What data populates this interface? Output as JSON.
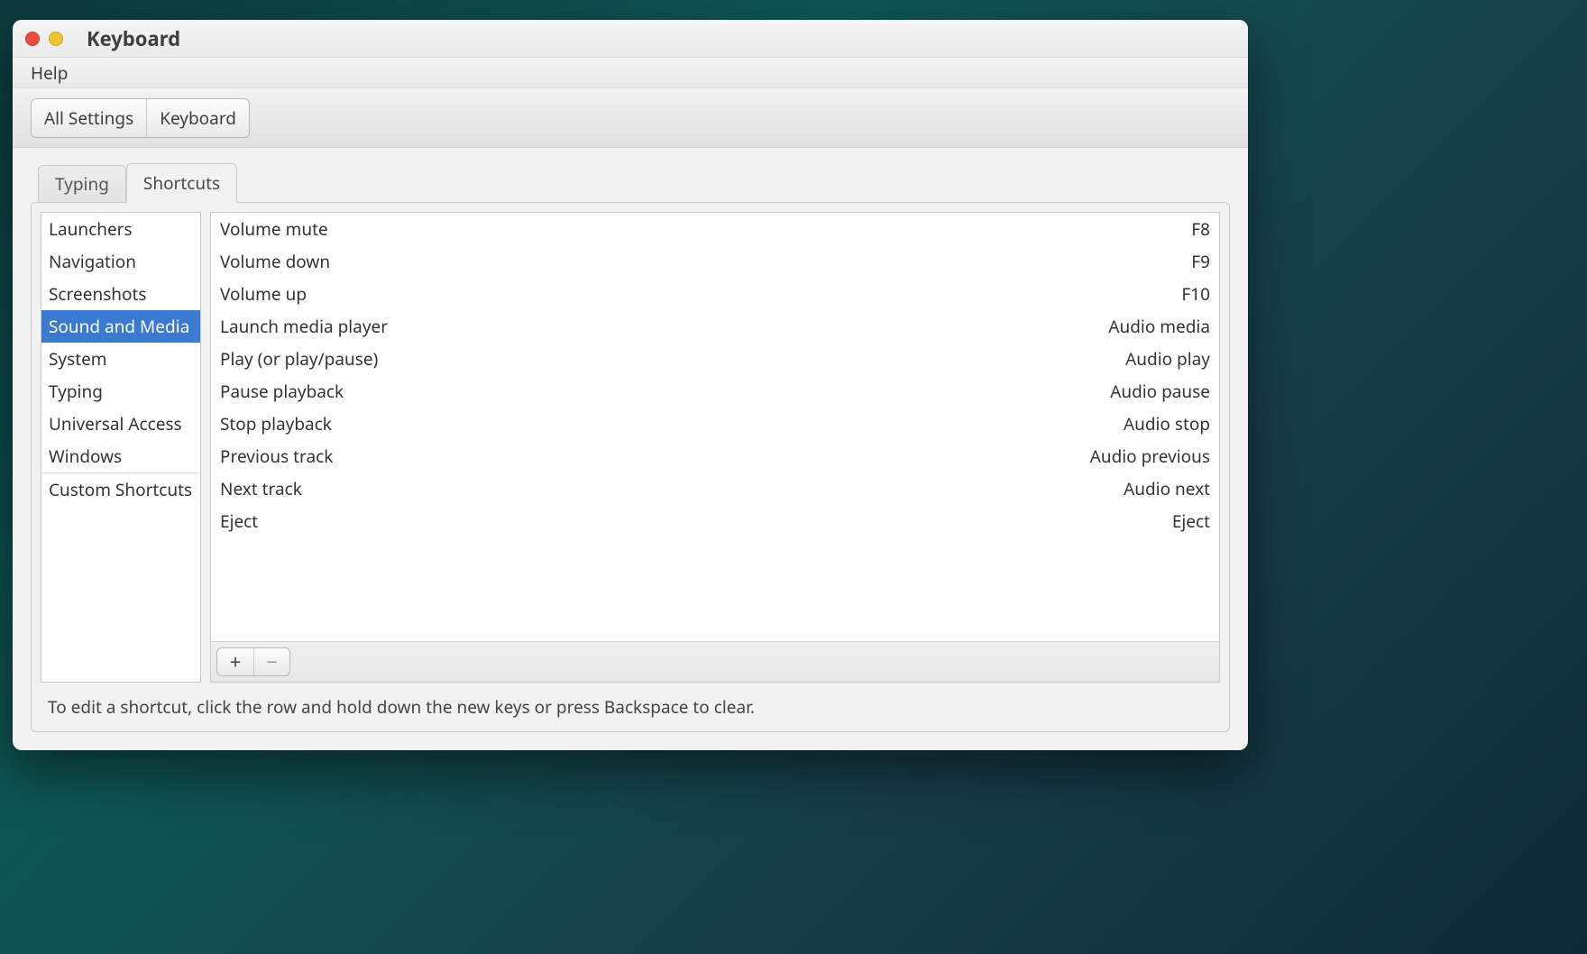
{
  "window": {
    "title": "Keyboard"
  },
  "menubar": {
    "help": "Help"
  },
  "breadcrumb": {
    "all_settings": "All Settings",
    "keyboard": "Keyboard"
  },
  "tabs": {
    "typing": "Typing",
    "shortcuts": "Shortcuts"
  },
  "sidebar": {
    "items": [
      "Launchers",
      "Navigation",
      "Screenshots",
      "Sound and Media",
      "System",
      "Typing",
      "Universal Access",
      "Windows"
    ],
    "custom": "Custom Shortcuts",
    "selected_index": 3
  },
  "shortcuts": [
    {
      "label": "Volume mute",
      "key": "F8"
    },
    {
      "label": "Volume down",
      "key": "F9"
    },
    {
      "label": "Volume up",
      "key": "F10"
    },
    {
      "label": "Launch media player",
      "key": "Audio media"
    },
    {
      "label": "Play (or play/pause)",
      "key": "Audio play"
    },
    {
      "label": "Pause playback",
      "key": "Audio pause"
    },
    {
      "label": "Stop playback",
      "key": "Audio stop"
    },
    {
      "label": "Previous track",
      "key": "Audio previous"
    },
    {
      "label": "Next track",
      "key": "Audio next"
    },
    {
      "label": "Eject",
      "key": "Eject"
    }
  ],
  "buttons": {
    "add": "+",
    "remove": "−"
  },
  "hint": "To edit a shortcut, click the row and hold down the new keys or press Backspace to clear."
}
